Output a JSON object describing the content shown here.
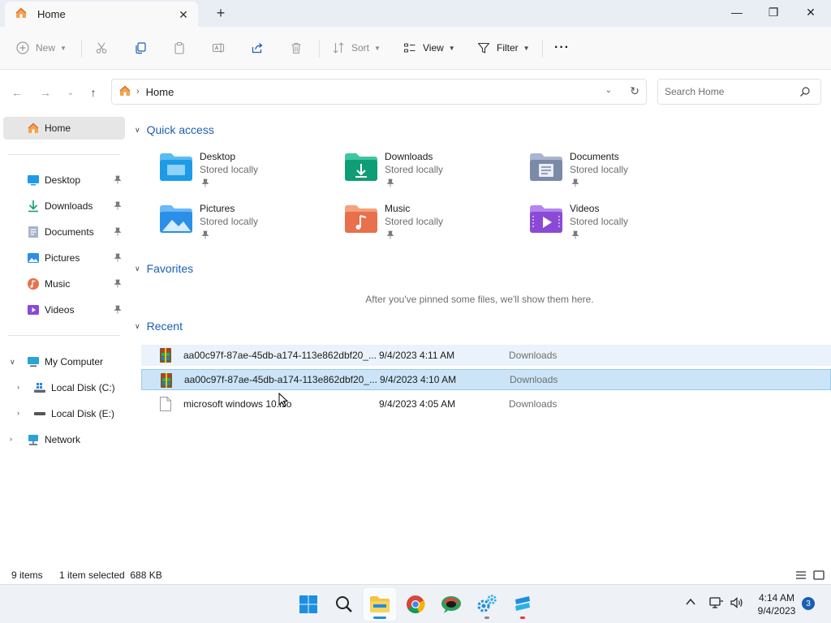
{
  "window": {
    "tab_title": "Home",
    "tab_close": "✕",
    "new_tab": "+",
    "minimize": "—",
    "maximize": "❐",
    "close": "✕"
  },
  "commandbar": {
    "new_label": "New",
    "sort_label": "Sort",
    "view_label": "View",
    "filter_label": "Filter",
    "more_label": "···"
  },
  "address": {
    "crumb": "Home",
    "search_placeholder": "Search Home"
  },
  "sidebar": {
    "home": "Home",
    "pinned": [
      {
        "label": "Desktop",
        "icon": "desktop-icon"
      },
      {
        "label": "Downloads",
        "icon": "downloads-icon"
      },
      {
        "label": "Documents",
        "icon": "documents-icon"
      },
      {
        "label": "Pictures",
        "icon": "pictures-icon"
      },
      {
        "label": "Music",
        "icon": "music-icon"
      },
      {
        "label": "Videos",
        "icon": "videos-icon"
      }
    ],
    "my_computer": "My Computer",
    "local_disk_c": "Local Disk (C:)",
    "local_disk_e": "Local Disk (E:)",
    "network": "Network"
  },
  "main": {
    "quick_access": {
      "title": "Quick access",
      "items": [
        {
          "name": "Desktop",
          "sub": "Stored locally",
          "color": "#1e9be6"
        },
        {
          "name": "Downloads",
          "sub": "Stored locally",
          "color": "#0f9d76"
        },
        {
          "name": "Documents",
          "sub": "Stored locally",
          "color": "#7a8aa8"
        },
        {
          "name": "Pictures",
          "sub": "Stored locally",
          "color": "#2b8fe8"
        },
        {
          "name": "Music",
          "sub": "Stored locally",
          "color": "#e8704a"
        },
        {
          "name": "Videos",
          "sub": "Stored locally",
          "color": "#8a4ad6"
        }
      ]
    },
    "favorites": {
      "title": "Favorites",
      "empty_text": "After you've pinned some files, we'll show them here."
    },
    "recent": {
      "title": "Recent",
      "rows": [
        {
          "name": "aa00c97f-87ae-45db-a174-113e862dbf20_...",
          "date": "9/4/2023 4:11 AM",
          "location": "Downloads"
        },
        {
          "name": "aa00c97f-87ae-45db-a174-113e862dbf20_...",
          "date": "9/4/2023 4:10 AM",
          "location": "Downloads"
        },
        {
          "name": "microsoft windows 10.iso",
          "date": "9/4/2023 4:05 AM",
          "location": "Downloads"
        }
      ]
    }
  },
  "status": {
    "items": "9 items",
    "selection": "1 item selected  688 KB"
  },
  "taskbar": {
    "time": "4:14 AM",
    "date": "9/4/2023",
    "notifications": "3"
  }
}
